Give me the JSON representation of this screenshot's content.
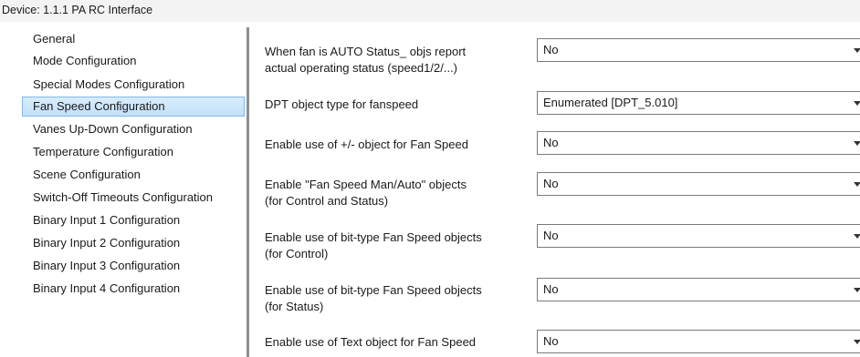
{
  "window": {
    "title": "Device: 1.1.1  PA RC Interface"
  },
  "sidebar": {
    "items": [
      {
        "label": "General"
      },
      {
        "label": "Mode Configuration"
      },
      {
        "label": "Special Modes Configuration"
      },
      {
        "label": "Fan Speed Configuration",
        "selected": true
      },
      {
        "label": "Vanes Up-Down Configuration"
      },
      {
        "label": "Temperature Configuration"
      },
      {
        "label": "Scene Configuration"
      },
      {
        "label": "Switch-Off Timeouts Configuration"
      },
      {
        "label": "Binary Input 1 Configuration"
      },
      {
        "label": "Binary Input 2 Configuration"
      },
      {
        "label": "Binary Input 3 Configuration"
      },
      {
        "label": "Binary Input 4 Configuration"
      }
    ]
  },
  "params": [
    {
      "line1": "When fan is AUTO Status_ objs report",
      "line2": "actual operating status (speed1/2/...)",
      "value": "No"
    },
    {
      "line1": "DPT object type for fanspeed",
      "line2": "",
      "value": "Enumerated [DPT_5.010]"
    },
    {
      "line1": "Enable use of +/- object for Fan Speed",
      "line2": "",
      "value": "No"
    },
    {
      "line1": "Enable \"Fan Speed Man/Auto\" objects",
      "line2": "(for Control and Status)",
      "value": "No"
    },
    {
      "line1": "Enable use of bit-type Fan Speed objects",
      "line2": "(for Control)",
      "value": "No"
    },
    {
      "line1": "Enable use of bit-type Fan Speed objects",
      "line2": "(for Status)",
      "value": "No"
    },
    {
      "line1": "Enable use of Text object for Fan Speed",
      "line2": "",
      "value": "No"
    }
  ],
  "colors": {
    "selection_fill": "#c9e3fb",
    "selection_border": "#7fb8ec",
    "divider": "#8e8e8e"
  }
}
